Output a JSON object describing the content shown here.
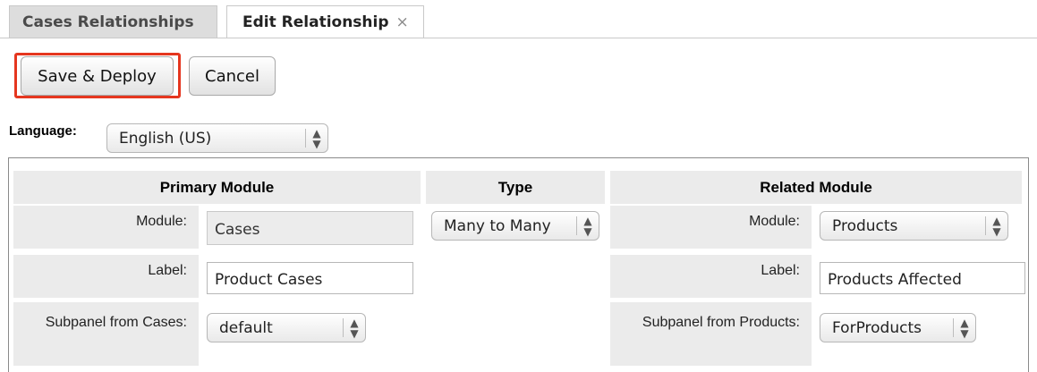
{
  "tabs": [
    {
      "label": "Cases Relationships"
    },
    {
      "label": "Edit Relationship",
      "close": "×"
    }
  ],
  "toolbar": {
    "save_label": "Save & Deploy",
    "cancel_label": "Cancel"
  },
  "language": {
    "label": "Language:",
    "selected": "English (US)"
  },
  "columns": {
    "primary": "Primary Module",
    "type": "Type",
    "related": "Related Module"
  },
  "primary": {
    "module_label": "Module:",
    "module_value": "Cases",
    "label_label": "Label:",
    "label_value": "Product Cases",
    "subpanel_label": "Subpanel from Cases:",
    "subpanel_value": "default"
  },
  "type": {
    "value": "Many to Many"
  },
  "related": {
    "module_label": "Module:",
    "module_value": "Products",
    "label_label": "Label:",
    "label_value": "Products Affected",
    "subpanel_label": "Subpanel from Products:",
    "subpanel_value": "ForProducts"
  },
  "icons": {
    "select_arrows": "up-down-arrows-icon",
    "close": "close-icon"
  },
  "colors": {
    "highlight": "#e5361f"
  }
}
